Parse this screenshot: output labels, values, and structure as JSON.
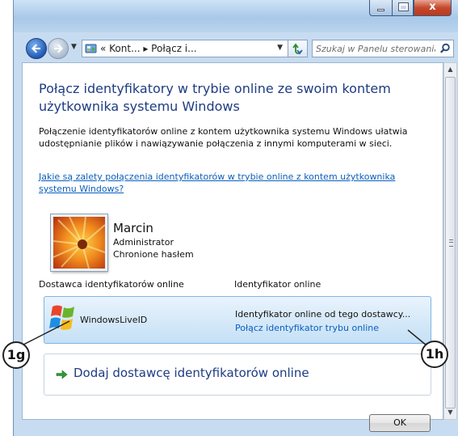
{
  "window": {
    "close_glyph": "x"
  },
  "navigation": {
    "breadcrumb": "« Kont... ▸ Połącz i...",
    "search_placeholder": "Szukaj w Panelu sterowania"
  },
  "main": {
    "title": "Połącz identyfikatory w trybie online ze swoim kontem użytkownika systemu Windows",
    "description": "Połączenie identyfikatorów online z kontem użytkownika systemu Windows ułatwia udostępnianie plików i nawiązywanie połączenia z innymi komputerami w sieci.",
    "benefits_link": "Jakie są zalety połączenia identyfikatorów w trybie online z kontem użytkownika systemu Windows?"
  },
  "user": {
    "name": "Marcin",
    "role": "Administrator",
    "status": "Chronione hasłem"
  },
  "providers": {
    "col_provider": "Dostawca identyfikatorów online",
    "col_online_id": "Identyfikator online",
    "rows": [
      {
        "name": "WindowsLiveID",
        "id_status": "Identyfikator online od tego dostawcy...",
        "action_link": "Połącz identyfikator trybu online"
      }
    ],
    "add_label": "Dodaj dostawcę identyfikatorów online"
  },
  "footer": {
    "ok_label": "OK"
  },
  "callouts": {
    "left": "1g",
    "right": "1h"
  },
  "colors": {
    "heading": "#1e3c82",
    "link": "#0a5fbc",
    "row_highlight": "#c5e0f6",
    "close_button": "#c7482c"
  }
}
